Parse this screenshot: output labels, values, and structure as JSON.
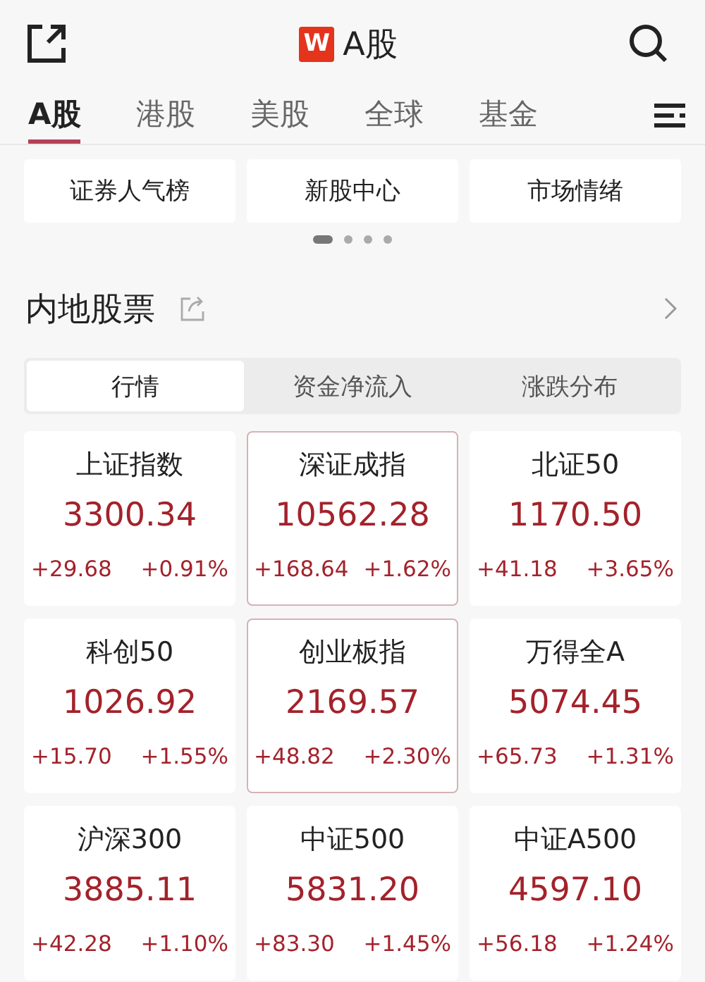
{
  "header": {
    "logo_text": "W",
    "title": "A股"
  },
  "tabs": [
    {
      "label": "A股",
      "selected": true
    },
    {
      "label": "港股",
      "selected": false
    },
    {
      "label": "美股",
      "selected": false
    },
    {
      "label": "全球",
      "selected": false
    },
    {
      "label": "基金",
      "selected": false
    }
  ],
  "shortcuts": [
    "证券人气榜",
    "新股中心",
    "市场情绪"
  ],
  "pager": [
    {
      "selected": true
    },
    {
      "selected": false
    },
    {
      "selected": false
    },
    {
      "selected": false
    }
  ],
  "section": {
    "title": "内地股票"
  },
  "segments": [
    {
      "label": "行情",
      "selected": true
    },
    {
      "label": "资金净流入",
      "selected": false
    },
    {
      "label": "涨跌分布",
      "selected": false
    }
  ],
  "indices": [
    {
      "name": "上证指数",
      "value": "3300.34",
      "change": "+29.68",
      "percent": "+0.91%",
      "outlined": false
    },
    {
      "name": "深证成指",
      "value": "10562.28",
      "change": "+168.64",
      "percent": "+1.62%",
      "outlined": true
    },
    {
      "name": "北证50",
      "value": "1170.50",
      "change": "+41.18",
      "percent": "+3.65%",
      "outlined": false
    },
    {
      "name": "科创50",
      "value": "1026.92",
      "change": "+15.70",
      "percent": "+1.55%",
      "outlined": false
    },
    {
      "name": "创业板指",
      "value": "2169.57",
      "change": "+48.82",
      "percent": "+2.30%",
      "outlined": true
    },
    {
      "name": "万得全A",
      "value": "5074.45",
      "change": "+65.73",
      "percent": "+1.31%",
      "outlined": false
    },
    {
      "name": "沪深300",
      "value": "3885.11",
      "change": "+42.28",
      "percent": "+1.10%",
      "outlined": false
    },
    {
      "name": "中证500",
      "value": "5831.20",
      "change": "+83.30",
      "percent": "+1.45%",
      "outlined": false
    },
    {
      "name": "中证A500",
      "value": "4597.10",
      "change": "+56.18",
      "percent": "+1.24%",
      "outlined": false
    }
  ]
}
